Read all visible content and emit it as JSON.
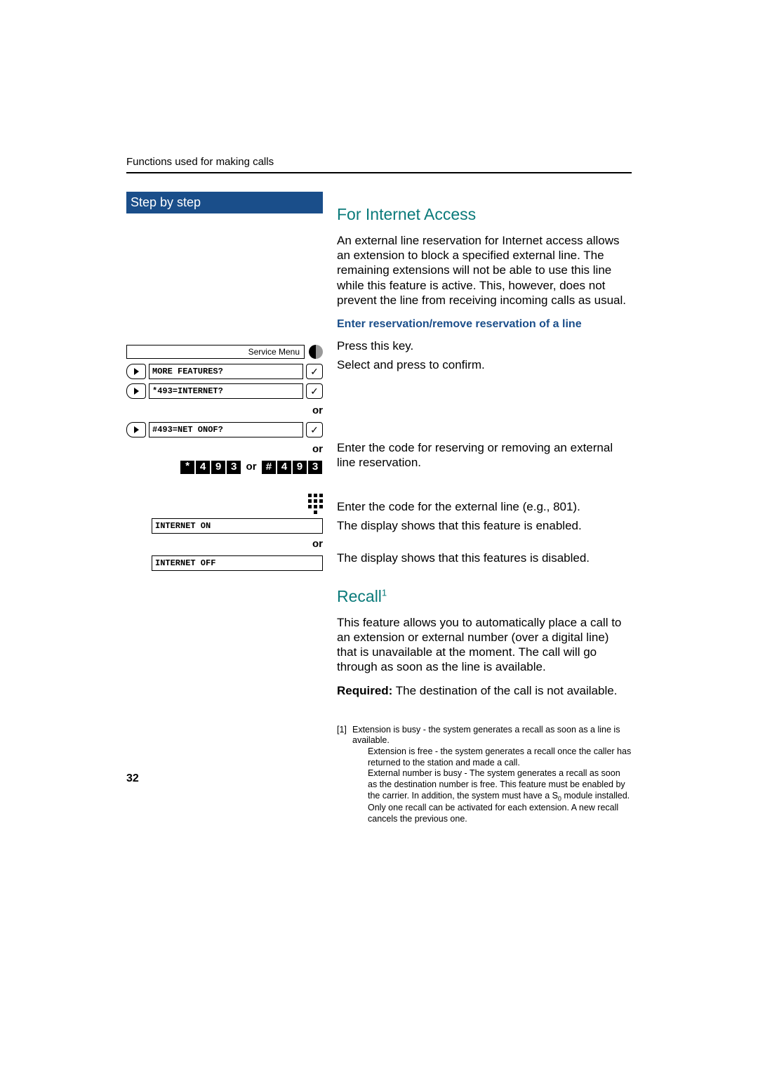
{
  "header": "Functions used for making calls",
  "sidebar": {
    "title": "Step by step",
    "service_menu": "Service Menu",
    "items": [
      {
        "label": "MORE FEATURES?"
      },
      {
        "label": "*493=INTERNET?"
      },
      {
        "label": "#493=NET ONOF?"
      }
    ],
    "or": "or",
    "code1": [
      "*",
      "4",
      "9",
      "3"
    ],
    "code_or": "or",
    "code2": [
      "#",
      "4",
      "9",
      "3"
    ],
    "display_on": "INTERNET ON",
    "display_off": "INTERNET OFF"
  },
  "sections": {
    "internet": {
      "title": "For Internet Access",
      "para1": "An external line reservation for Internet access allows an extension to block  a specified external line. The remaining extensions will not be able to use this line while this feature is active. This, however, does not prevent the line from receiving incoming calls as usual.",
      "sub_title": "Enter reservation/remove reservation of a line",
      "press_key": "Press this key.",
      "select_confirm": "Select and press to confirm.",
      "enter_code": "Enter the code for reserving or removing an external line reservation.",
      "enter_ext": "Enter the code for the external line (e.g., 801).",
      "enabled": "The display shows that this feature is enabled.",
      "disabled": "The display shows that this features is disabled."
    },
    "recall": {
      "title": "Recall",
      "sup": "1",
      "para1": "This feature allows you to automatically place a call to an extension or external number (over a digital line) that is unavailable at the moment. The call will go through as soon as the line is available.",
      "required_label": "Required:",
      "required_text": " The destination of the call is not available."
    }
  },
  "footnote": {
    "num": "[1]",
    "l1": "Extension is busy - the system generates a recall as soon as a line is available.",
    "l2": "Extension is free - the system generates a recall once the caller has returned to the station and made a call.",
    "l3a": "External number is busy - The system generates a recall as soon as the destination number is free. This feature must be enabled by the carrier. In addition, the system must have a S",
    "l3sub": "0",
    "l3b": " module installed.",
    "l4": "Only one recall can be activated for each extension.  A new recall cancels the previous one."
  },
  "page_number": "32"
}
